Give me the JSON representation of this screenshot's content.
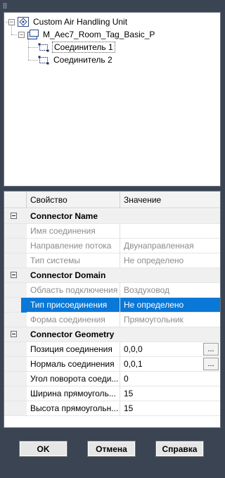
{
  "tree": {
    "root": {
      "label": "Custom Air Handling Unit",
      "icon": "family-icon"
    },
    "child": {
      "label": "M_Aec7_Room_Tag_Basic_P",
      "icon": "component-icon"
    },
    "connectors": [
      {
        "label": "Соединитель 1",
        "icon": "connector-icon",
        "selected": true
      },
      {
        "label": "Соединитель 2",
        "icon": "connector-icon",
        "selected": false
      }
    ]
  },
  "grid": {
    "header": {
      "property": "Свойство",
      "value": "Значение"
    },
    "rows": [
      {
        "kind": "category",
        "label": "Connector Name"
      },
      {
        "kind": "prop",
        "name": "Имя соединения",
        "value": "",
        "disabled": true
      },
      {
        "kind": "prop",
        "name": "Направление потока",
        "value": "Двунаправленная",
        "disabled": true
      },
      {
        "kind": "prop",
        "name": "Тип системы",
        "value": "Не определено",
        "disabled": true
      },
      {
        "kind": "category",
        "label": "Connector Domain"
      },
      {
        "kind": "prop",
        "name": "Область подключения",
        "value": "Воздуховод",
        "disabled": true
      },
      {
        "kind": "prop",
        "name": "Тип присоединения",
        "value": "Не определено",
        "selected": true
      },
      {
        "kind": "prop",
        "name": "Форма соединения",
        "value": "Прямоугольник",
        "disabled": true
      },
      {
        "kind": "category",
        "label": "Connector Geometry"
      },
      {
        "kind": "prop",
        "name": "Позиция соединения",
        "value": "0,0,0",
        "button": "..."
      },
      {
        "kind": "prop",
        "name": "Нормаль соединения",
        "value": "0,0,1",
        "button": "..."
      },
      {
        "kind": "prop",
        "name": "Угол поворота соеди...",
        "value": "0"
      },
      {
        "kind": "prop",
        "name": "Ширина прямоуголь...",
        "value": "15"
      },
      {
        "kind": "prop",
        "name": "Высота прямоугольн...",
        "value": "15"
      }
    ]
  },
  "buttons": {
    "ok": "OK",
    "cancel": "Отмена",
    "help": "Справка"
  },
  "colors": {
    "background": "#3b4452",
    "selection": "#0a78d7",
    "disabled_text": "#8c8c8c"
  }
}
